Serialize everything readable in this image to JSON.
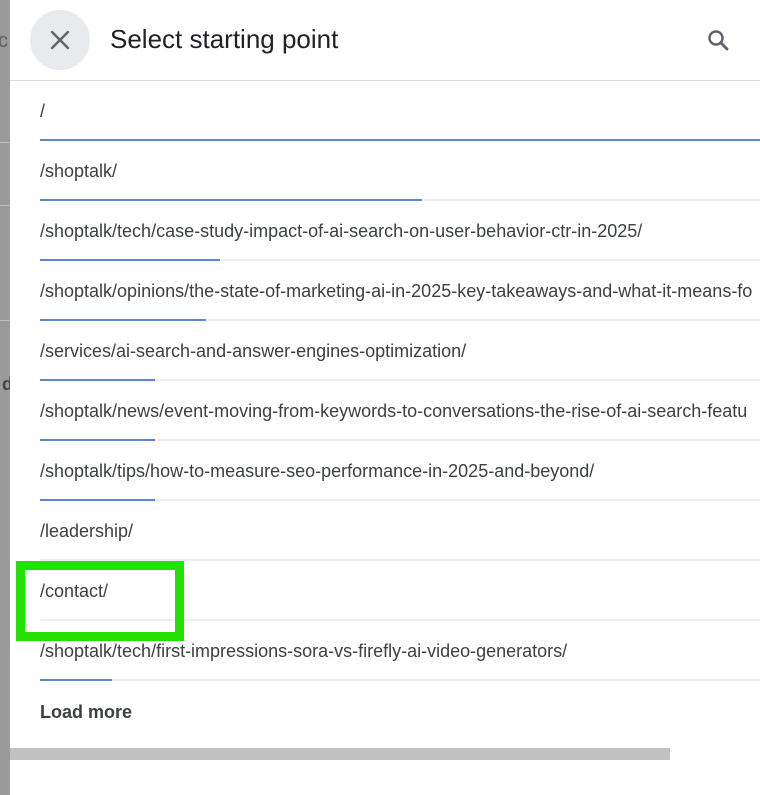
{
  "dialog": {
    "title": "Select starting point",
    "close_icon": "close-icon",
    "search_icon": "search-icon"
  },
  "paths": [
    {
      "label": "/",
      "share": 1.0
    },
    {
      "label": "/shoptalk/",
      "share": 0.53
    },
    {
      "label": "/shoptalk/tech/case-study-impact-of-ai-search-on-user-behavior-ctr-in-2025/",
      "share": 0.25
    },
    {
      "label": "/shoptalk/opinions/the-state-of-marketing-ai-in-2025-key-takeaways-and-what-it-means-fo",
      "share": 0.23
    },
    {
      "label": "/services/ai-search-and-answer-engines-optimization/",
      "share": 0.16
    },
    {
      "label": "/shoptalk/news/event-moving-from-keywords-to-conversations-the-rise-of-ai-search-featu",
      "share": 0.16
    },
    {
      "label": "/shoptalk/tips/how-to-measure-seo-performance-in-2025-and-beyond/",
      "share": 0.16
    },
    {
      "label": "/leadership/",
      "share": 0
    },
    {
      "label": "/contact/",
      "share": 0
    },
    {
      "label": "/shoptalk/tech/first-impressions-sora-vs-firefly-ai-video-generators/",
      "share": 0.1
    }
  ],
  "load_more_label": "Load more",
  "colors": {
    "bar": "#5b87d2",
    "highlight": "#22e000",
    "close_button_bg": "#e8eaed"
  }
}
